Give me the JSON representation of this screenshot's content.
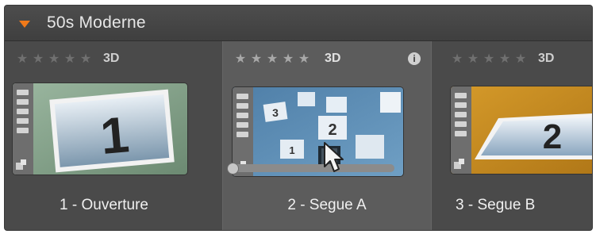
{
  "header": {
    "title": "50s Moderne"
  },
  "tiles": [
    {
      "label": "1 - Ouverture",
      "badge": "3D",
      "rating": 0,
      "thumb_number": "1"
    },
    {
      "label": "2 - Segue A",
      "badge": "3D",
      "rating": 0,
      "thumb_number": "2",
      "selected": true,
      "info": "i"
    },
    {
      "label": "3 - Segue B",
      "badge": "3D",
      "rating": 0,
      "thumb_number": "2"
    }
  ],
  "icons": {
    "collapse": "caret-down-icon",
    "star": "star-icon",
    "info": "info-icon",
    "film": "film-strip-icon",
    "cursor": "mouse-pointer-icon"
  },
  "colors": {
    "accent": "#f07a1a",
    "panel": "#4a4a4a",
    "selected_tile": "#5c5c5c"
  }
}
